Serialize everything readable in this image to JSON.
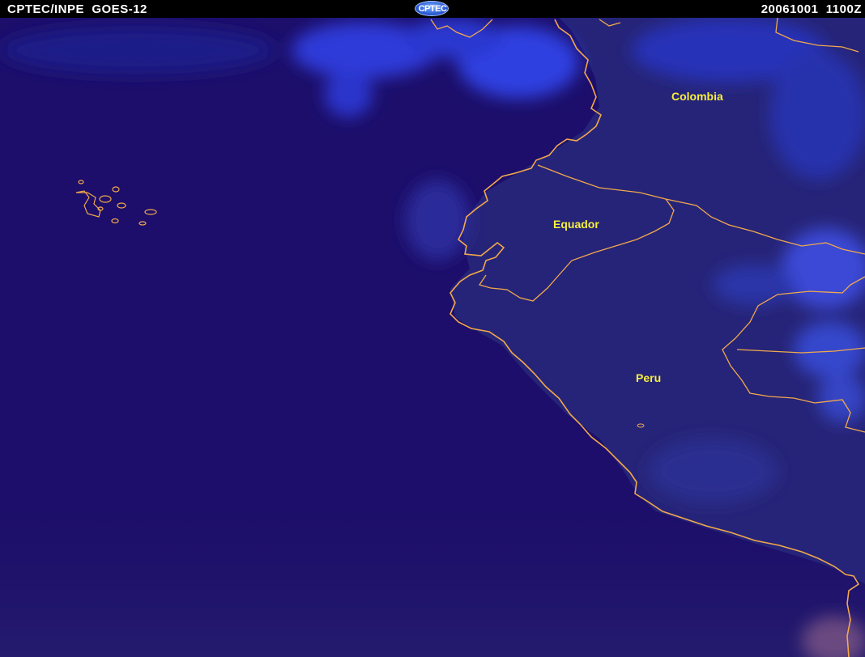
{
  "header": {
    "left_title": "CPTEC/INPE  GOES-12",
    "right_title": "20061001  1100Z",
    "logo_text": "CPTEC"
  },
  "labels": {
    "colombia": "Colombia",
    "equador": "Equador",
    "peru": "Peru"
  },
  "colors": {
    "ocean": "#1c0e6a",
    "land": "#262474",
    "cloud": "#2a39d6",
    "border": "#f2a84c",
    "label": "#f7ef3c",
    "header_bg": "#000000",
    "header_text": "#ffffff"
  }
}
